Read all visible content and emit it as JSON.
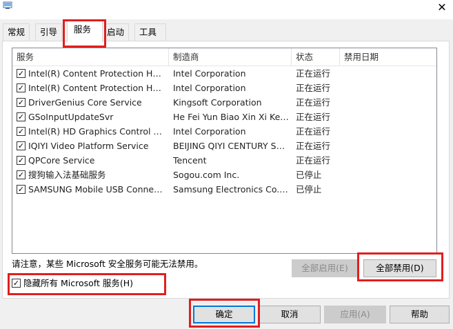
{
  "tabs": [
    {
      "label": "常规"
    },
    {
      "label": "引导"
    },
    {
      "label": "服务"
    },
    {
      "label": "启动"
    },
    {
      "label": "工具"
    }
  ],
  "active_tab": "服务",
  "columns": {
    "service": "服务",
    "manufacturer": "制造商",
    "status": "状态",
    "disabled_date": "禁用日期"
  },
  "rows": [
    {
      "service": "Intel(R) Content Protection HECI ...",
      "manufacturer": "Intel Corporation",
      "status": "正在运行",
      "checked": true
    },
    {
      "service": "Intel(R) Content Protection HDCP...",
      "manufacturer": "Intel Corporation",
      "status": "正在运行",
      "checked": true
    },
    {
      "service": "DriverGenius Core Service",
      "manufacturer": "Kingsoft Corporation",
      "status": "正在运行",
      "checked": true
    },
    {
      "service": "GSoInputUpdateSvr",
      "manufacturer": "He Fei Yun Biao Xin Xi Ke J...",
      "status": "正在运行",
      "checked": true
    },
    {
      "service": "Intel(R) HD Graphics Control Pan...",
      "manufacturer": "Intel Corporation",
      "status": "正在运行",
      "checked": true
    },
    {
      "service": "IQIYI Video Platform Service",
      "manufacturer": "BEIJING QIYI CENTURY SC...",
      "status": "正在运行",
      "checked": true
    },
    {
      "service": "QPCore Service",
      "manufacturer": "Tencent",
      "status": "正在运行",
      "checked": true
    },
    {
      "service": "搜狗输入法基础服务",
      "manufacturer": "Sogou.com Inc.",
      "status": "已停止",
      "checked": true
    },
    {
      "service": "SAMSUNG Mobile USB Connecti...",
      "manufacturer": "Samsung Electronics Co., L...",
      "status": "已停止",
      "checked": true
    }
  ],
  "note": "请注意，某些 Microsoft 安全服务可能无法禁用。",
  "buttons": {
    "enable_all": "全部启用(E)",
    "disable_all": "全部禁用(D)",
    "ok": "确定",
    "cancel": "取消",
    "apply": "应用(A)",
    "help": "帮助"
  },
  "hide_ms": {
    "label": "隐藏所有 Microsoft 服务(H)",
    "checked": true
  },
  "colors": {
    "highlight": "#e01e1e",
    "default_button_border": "#0078d7"
  }
}
